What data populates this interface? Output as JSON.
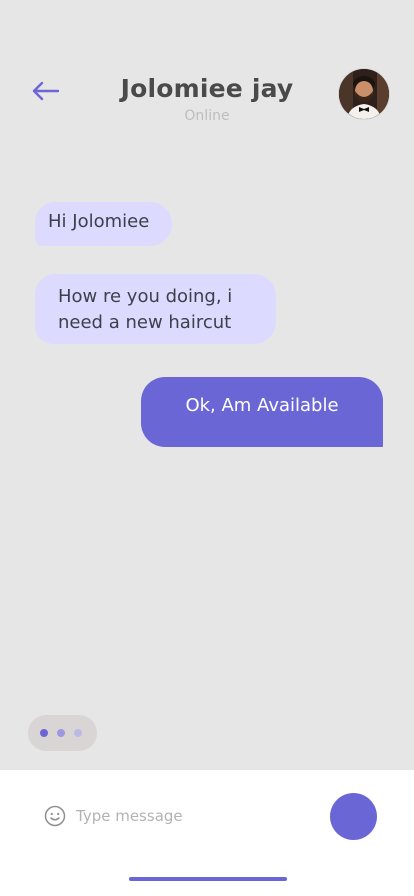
{
  "header": {
    "back_icon": "arrow-left-icon",
    "contact_name": "Jolomiee jay",
    "status": "Online",
    "avatar_icon": "profile-photo"
  },
  "messages": [
    {
      "direction": "incoming",
      "text": "Hi Jolomiee"
    },
    {
      "direction": "incoming",
      "text": "How re you doing, i need a new haircut"
    },
    {
      "direction": "outgoing",
      "text": "Ok, Am Available"
    }
  ],
  "typing_indicator": {
    "dots": 3,
    "dot_colors": [
      "#6b66d6",
      "#9d98e0",
      "#bcb8e6"
    ]
  },
  "composer": {
    "emoji_icon": "smiley-icon",
    "placeholder": "Type message",
    "value": "",
    "send_icon": "send-icon"
  },
  "colors": {
    "accent": "#6b66d6",
    "incoming_bubble": "#dcdaff",
    "background": "#e6e6e6"
  }
}
